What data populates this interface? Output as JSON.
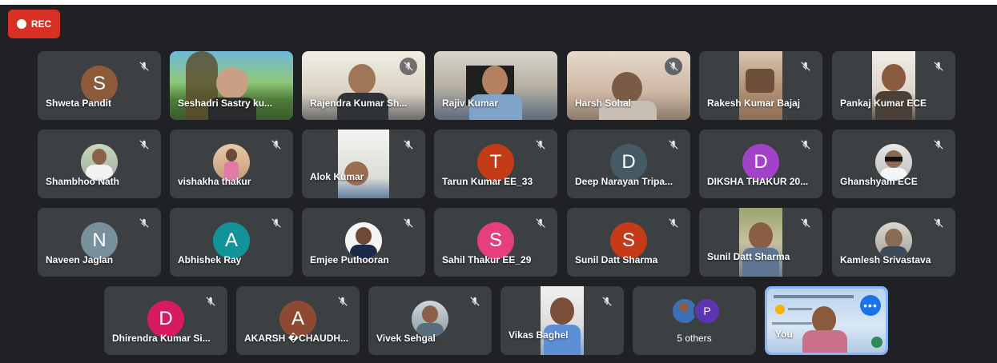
{
  "recording": {
    "label": "REC"
  },
  "tiles": [
    {
      "name": "Shweta Pandit",
      "initial": "S",
      "color": "#8d5a3a"
    },
    {
      "name": "Seshadri Sastry ku..."
    },
    {
      "name": "Rajendra Kumar Sh..."
    },
    {
      "name": "Rajiv Kumar"
    },
    {
      "name": "Harsh Sohal"
    },
    {
      "name": "Rakesh Kumar Bajaj"
    },
    {
      "name": "Pankaj Kumar ECE"
    },
    {
      "name": "Shambhoo Nath"
    },
    {
      "name": "vishakha thakur"
    },
    {
      "name": "Alok Kumar"
    },
    {
      "name": "Tarun Kumar EE_33",
      "initial": "T",
      "color": "#c53b17"
    },
    {
      "name": "Deep Narayan Tripa...",
      "initial": "D",
      "color": "#455a64"
    },
    {
      "name": "DIKSHA THAKUR 20...",
      "initial": "D",
      "color": "#a142c8"
    },
    {
      "name": "Ghanshyam ECE"
    },
    {
      "name": "Naveen Jaglan",
      "initial": "N",
      "color": "#78909c"
    },
    {
      "name": "Abhishek Ray",
      "initial": "A",
      "color": "#12939a"
    },
    {
      "name": "Emjee Puthooran"
    },
    {
      "name": "Sahil Thakur EE_29",
      "initial": "S",
      "color": "#e5407b"
    },
    {
      "name": "Sunil Datt Sharma",
      "initial": "S",
      "color": "#c53b17"
    },
    {
      "name": "Sunil Datt Sharma"
    },
    {
      "name": "Kamlesh Srivastava"
    },
    {
      "name": "Dhirendra Kumar Si...",
      "initial": "D",
      "color": "#d81b60"
    },
    {
      "name": "AKARSH �CHAUDH...",
      "initial": "A",
      "color": "#8d4a32"
    },
    {
      "name": "Vivek Sehgal"
    },
    {
      "name": "Vikas Baghel"
    }
  ],
  "others": {
    "label": "5 others",
    "initial": "P",
    "color": "#5e35b1"
  },
  "self": {
    "name": "You",
    "more": "•••"
  }
}
